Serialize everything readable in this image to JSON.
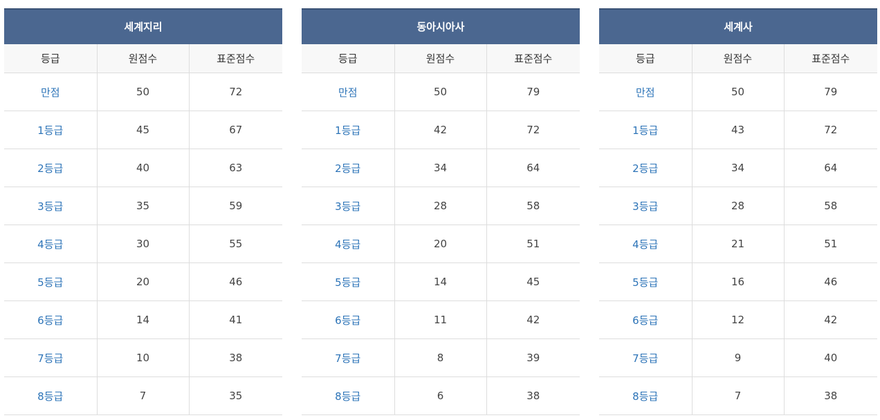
{
  "columns": [
    "등급",
    "원점수",
    "표준점수"
  ],
  "accent_color": "#4b6790",
  "grade_text_color": "#2d74b8",
  "tables": [
    {
      "title": "세계지리",
      "rows": [
        [
          "만점",
          "50",
          "72"
        ],
        [
          "1등급",
          "45",
          "67"
        ],
        [
          "2등급",
          "40",
          "63"
        ],
        [
          "3등급",
          "35",
          "59"
        ],
        [
          "4등급",
          "30",
          "55"
        ],
        [
          "5등급",
          "20",
          "46"
        ],
        [
          "6등급",
          "14",
          "41"
        ],
        [
          "7등급",
          "10",
          "38"
        ],
        [
          "8등급",
          "7",
          "35"
        ]
      ]
    },
    {
      "title": "동아시아사",
      "rows": [
        [
          "만점",
          "50",
          "79"
        ],
        [
          "1등급",
          "42",
          "72"
        ],
        [
          "2등급",
          "34",
          "64"
        ],
        [
          "3등급",
          "28",
          "58"
        ],
        [
          "4등급",
          "20",
          "51"
        ],
        [
          "5등급",
          "14",
          "45"
        ],
        [
          "6등급",
          "11",
          "42"
        ],
        [
          "7등급",
          "8",
          "39"
        ],
        [
          "8등급",
          "6",
          "38"
        ]
      ]
    },
    {
      "title": "세계사",
      "rows": [
        [
          "만점",
          "50",
          "79"
        ],
        [
          "1등급",
          "43",
          "72"
        ],
        [
          "2등급",
          "34",
          "64"
        ],
        [
          "3등급",
          "28",
          "58"
        ],
        [
          "4등급",
          "21",
          "51"
        ],
        [
          "5등급",
          "16",
          "46"
        ],
        [
          "6등급",
          "12",
          "42"
        ],
        [
          "7등급",
          "9",
          "40"
        ],
        [
          "8등급",
          "7",
          "38"
        ]
      ]
    }
  ]
}
